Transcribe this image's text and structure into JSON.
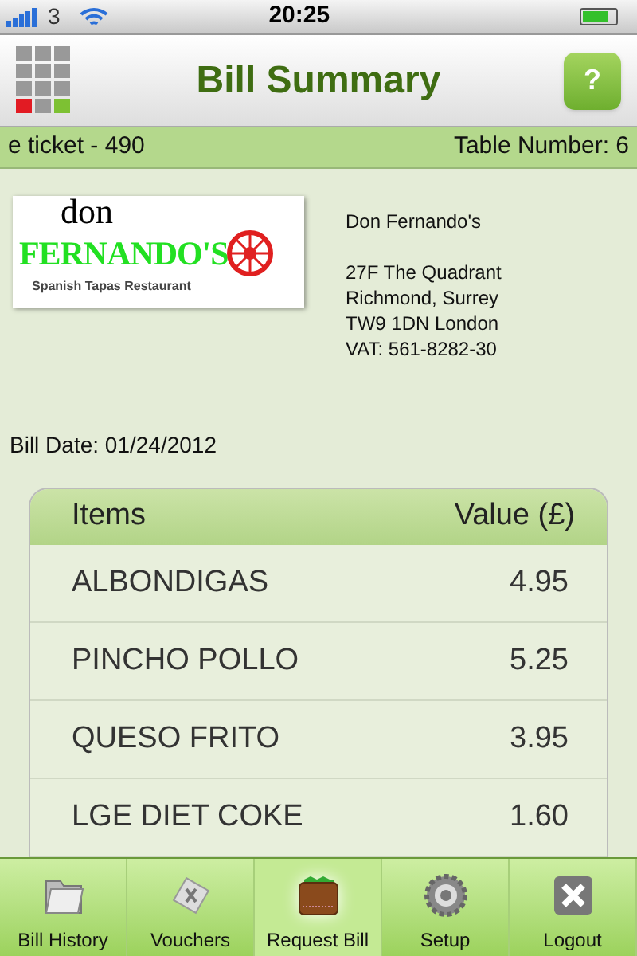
{
  "status_bar": {
    "carrier": "3",
    "time": "20:25",
    "battery": {
      "level": 0.8
    }
  },
  "header": {
    "title": "Bill Summary",
    "help_button": "?"
  },
  "ticket_bar": {
    "ticket": "e ticket - 490",
    "table": "Table Number: 6"
  },
  "logo": {
    "top": "don",
    "name": "FERNANDO'S",
    "tagline": "Spanish Tapas Restaurant"
  },
  "restaurant": {
    "name": "Don Fernando's",
    "address": [
      "27F The Quadrant",
      "Richmond, Surrey",
      "TW9 1DN London",
      "VAT: 561-8282-30"
    ]
  },
  "bill_date": "Bill Date: 01/24/2012",
  "table": {
    "columns": [
      "Items",
      "Value (£)"
    ],
    "rows": [
      {
        "item": "ALBONDIGAS",
        "value": "4.95"
      },
      {
        "item": "PINCHO POLLO",
        "value": "5.25"
      },
      {
        "item": "QUESO FRITO",
        "value": "3.95"
      },
      {
        "item": "LGE DIET COKE",
        "value": "1.60"
      }
    ]
  },
  "tab_bar": [
    {
      "label": "Bill History",
      "kind": "folder",
      "selected": false
    },
    {
      "label": "Vouchers",
      "kind": "voucher",
      "selected": false
    },
    {
      "label": "Request Bill",
      "kind": "wallet",
      "selected": true
    },
    {
      "label": "Setup",
      "kind": "gear",
      "selected": false
    },
    {
      "label": "Logout",
      "kind": "close",
      "selected": false
    }
  ]
}
